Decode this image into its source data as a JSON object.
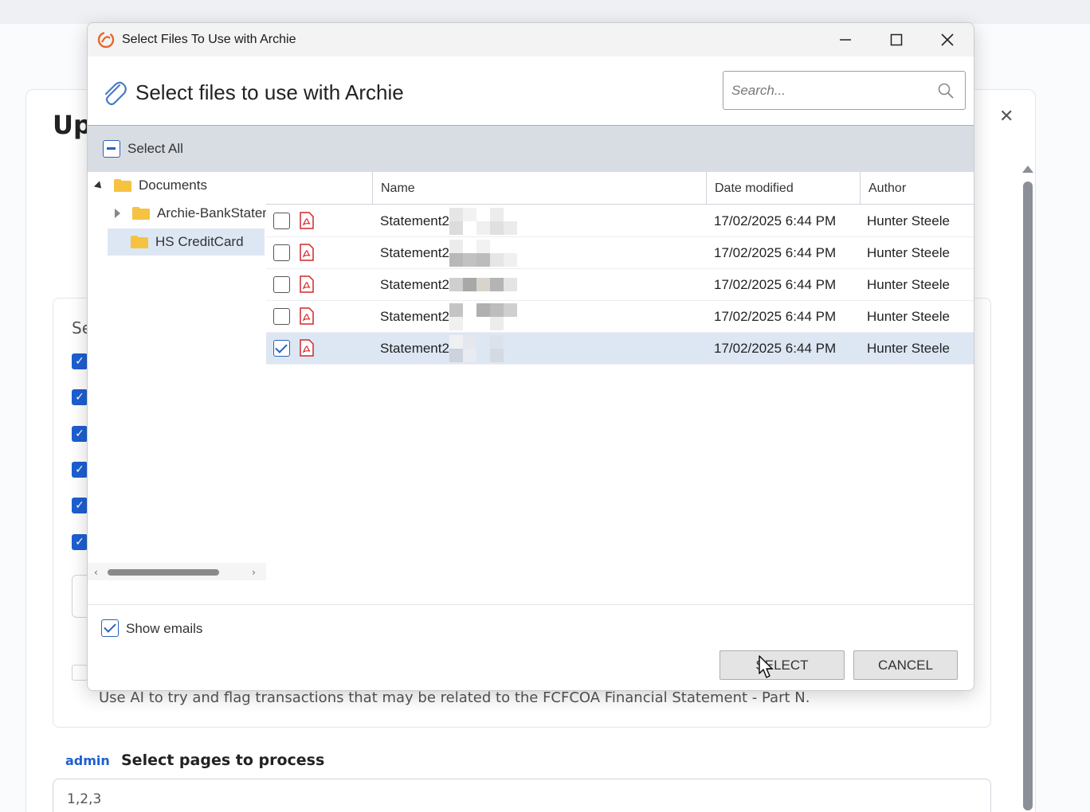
{
  "background": {
    "heading": "Up",
    "section_prefix": "Se",
    "description": "Use AI to try and flag transactions that may be related to the FCFCOA Financial Statement - Part N.",
    "admin_tag": "admin",
    "pages_label": "Select pages to process",
    "pages_value": "1,2,3"
  },
  "dialog": {
    "window_title": "Select Files To Use with Archie",
    "heading": "Select files to use with Archie",
    "search_placeholder": "Search...",
    "select_all_label": "Select All",
    "tree": [
      {
        "label": "Documents",
        "expanded": true
      },
      {
        "label": "Archie-BankStatements",
        "expanded": false
      },
      {
        "label": "HS CreditCard",
        "selected": true
      }
    ],
    "columns": [
      "Name",
      "Date modified",
      "Author"
    ],
    "files": [
      {
        "name": "Statement2",
        "date": "17/02/2025 6:44 PM",
        "author": "Hunter Steele",
        "checked": false
      },
      {
        "name": "Statement2",
        "date": "17/02/2025 6:44 PM",
        "author": "Hunter Steele",
        "checked": false
      },
      {
        "name": "Statement2",
        "date": "17/02/2025 6:44 PM",
        "author": "Hunter Steele",
        "checked": false
      },
      {
        "name": "Statement2",
        "date": "17/02/2025 6:44 PM",
        "author": "Hunter Steele",
        "checked": false
      },
      {
        "name": "Statement2",
        "date": "17/02/2025 6:44 PM",
        "author": "Hunter Steele",
        "checked": true
      }
    ],
    "show_emails_label": "Show emails",
    "show_emails_checked": true,
    "select_button": "SELECT",
    "cancel_button": "CANCEL"
  },
  "colors": {
    "accent": "#2a62b8",
    "selected_row": "#dde7f3",
    "pdf_red": "#d4262c",
    "folder_yellow": "#f5c242"
  }
}
